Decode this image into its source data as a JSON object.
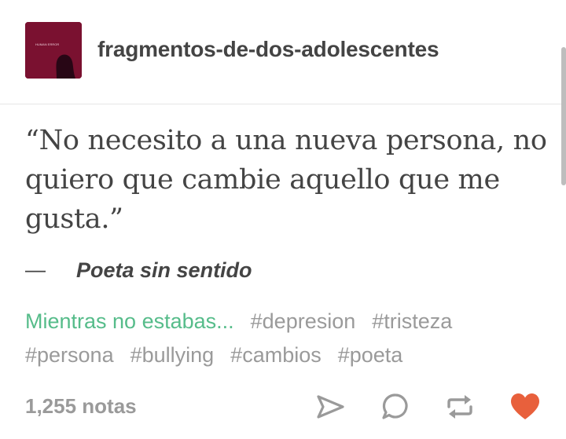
{
  "post": {
    "blog_name": "fragmentos-de-dos-adolescentes",
    "avatar_caption": "HUMAN ERROR",
    "quote_lines": [
      "“No necesito a una nueva persona, no",
      "quiero que cambie aquello que me",
      "gusta.”"
    ],
    "source_dash": "—",
    "source": "Poeta sin sentido",
    "tags": [
      "Mientras no estabas...",
      "#depresion",
      "#tristeza",
      "#persona",
      "#bullying",
      "#cambios",
      "#poeta"
    ],
    "notes": "1,255 notas"
  },
  "icons": {
    "share": "paper-plane-icon",
    "reply": "speech-bubble-icon",
    "reblog": "reblog-arrows-icon",
    "like": "heart-icon"
  },
  "colors": {
    "text": "#444444",
    "muted": "#9a9a9a",
    "featured_tag": "#56bc8a",
    "like": "#e8603c",
    "avatar_bg": "#8a1436"
  }
}
